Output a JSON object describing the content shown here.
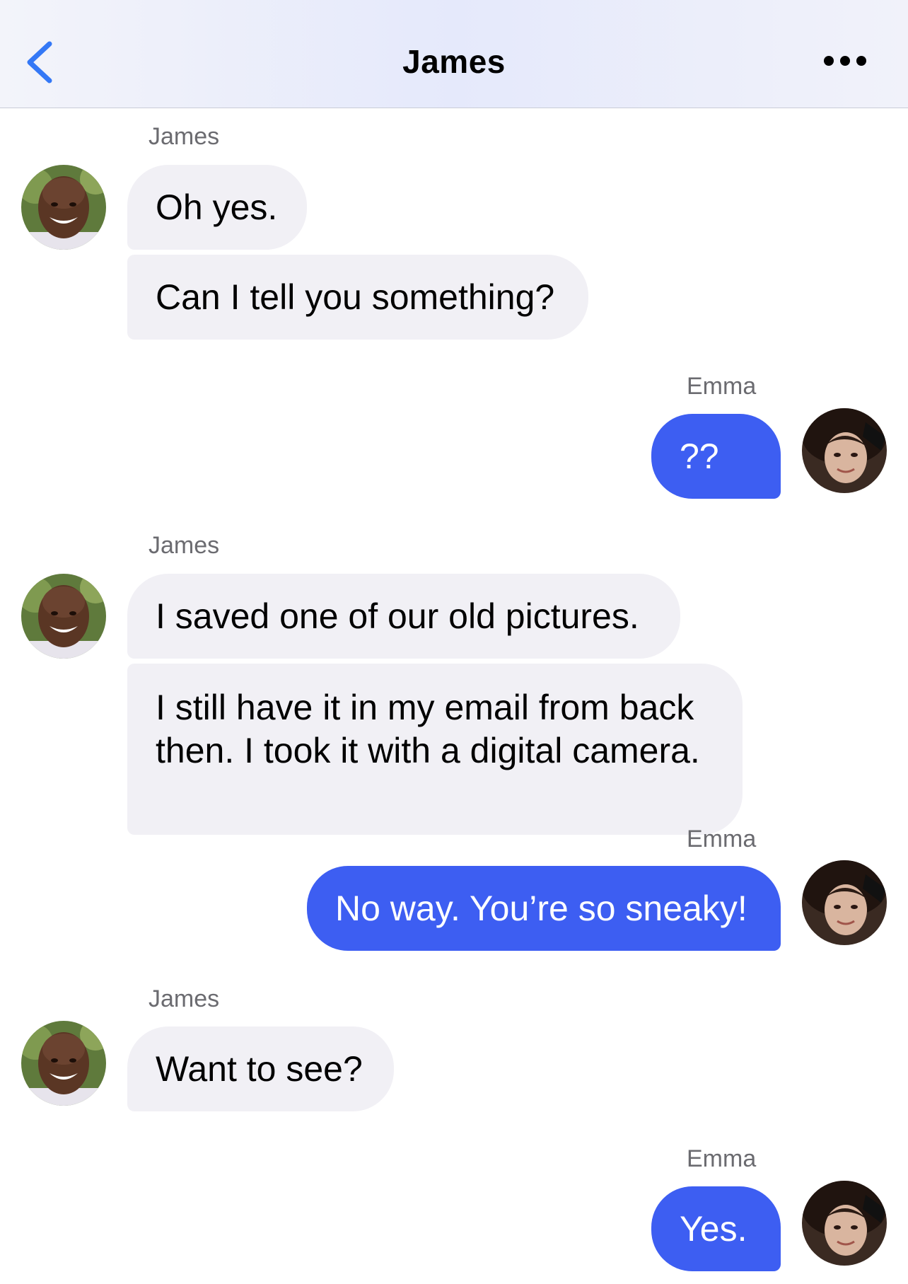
{
  "header": {
    "title": "James",
    "back_icon": "chevron-left-icon",
    "more_icon": "more-horizontal-icon",
    "accent_color": "#3478f6"
  },
  "colors": {
    "incoming_bubble": "#f1f0f5",
    "outgoing_bubble": "#3d5ef2"
  },
  "messages": [
    {
      "sender": "James",
      "text": "Oh yes."
    },
    {
      "sender": "James",
      "text": "Can I tell you something?"
    },
    {
      "sender": "Emma",
      "text": "??"
    },
    {
      "sender": "James",
      "text": "I saved one of our old pictures."
    },
    {
      "sender": "James",
      "text": "I still have it in my email from back then. I took it with a digital camera."
    },
    {
      "sender": "Emma",
      "text": "No way. You’re so sneaky!"
    },
    {
      "sender": "James",
      "text": "Want to see?"
    },
    {
      "sender": "Emma",
      "text": "Yes."
    }
  ],
  "labels": {
    "james": "James",
    "emma": "Emma"
  }
}
